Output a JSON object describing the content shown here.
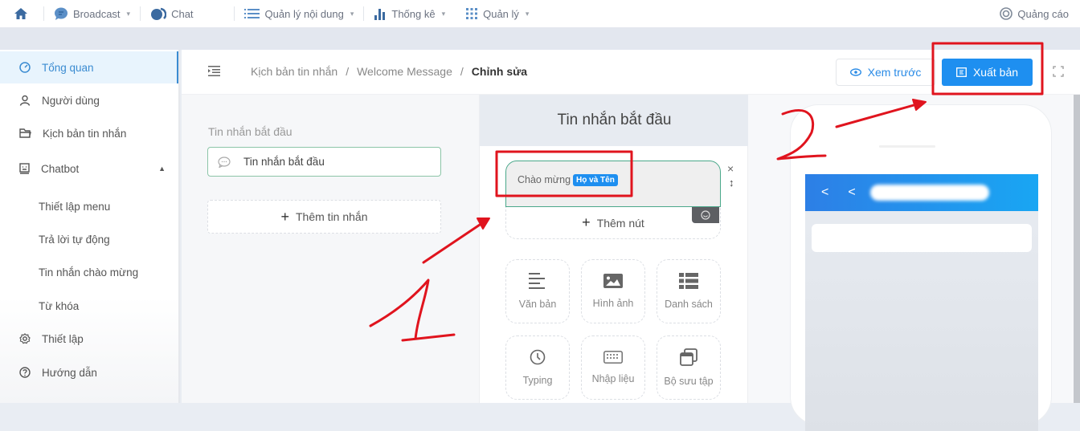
{
  "topnav": {
    "home_icon": "home-icon",
    "items": [
      {
        "label": "Broadcast",
        "icon": "chat-bubble-icon",
        "dropdown": true
      },
      {
        "label": "Chat",
        "icon": "chat-bubbles-icon",
        "dropdown": false
      },
      {
        "label": "Quản lý nội dung",
        "icon": "list-icon",
        "dropdown": true
      },
      {
        "label": "Thống kê",
        "icon": "bar-chart-icon",
        "dropdown": true
      },
      {
        "label": "Quản lý",
        "icon": "grid-icon",
        "dropdown": true
      }
    ],
    "caret": "▾",
    "ads": {
      "label": "Quảng cáo",
      "icon": "target-icon"
    }
  },
  "sidebar": {
    "items": [
      {
        "label": "Tổng quan",
        "icon": "dashboard-icon",
        "active": true
      },
      {
        "label": "Người dùng",
        "icon": "user-icon"
      },
      {
        "label": "Kịch bản tin nhắn",
        "icon": "folder-icon"
      },
      {
        "label": "Chatbot",
        "icon": "bot-icon",
        "expanded": true
      },
      {
        "label": "Thiết lập",
        "icon": "gear-icon"
      },
      {
        "label": "Hướng dẫn",
        "icon": "help-icon"
      }
    ],
    "chatbot_sub": [
      "Thiết lập menu",
      "Trả lời tự động",
      "Tin nhắn chào mừng",
      "Từ khóa"
    ],
    "collapse_glyph": "▲"
  },
  "header": {
    "breadcrumb": [
      "Kịch bản tin nhắn",
      "Welcome Message",
      "Chỉnh sửa"
    ],
    "separator": "/",
    "preview_label": "Xem trước",
    "publish_label": "Xuất bản"
  },
  "left_panel": {
    "section_label": "Tin nhắn bắt đầu",
    "message_item": "Tin nhắn bắt đầu",
    "add_message_label": "Thêm tin nhắn"
  },
  "editor": {
    "title": "Tin nhắn bắt đầu",
    "bubble_text": "Chào mừng",
    "bubble_tag": "Họ và Tên",
    "close_glyph": "×",
    "resize_glyph": "↕",
    "add_button_label": "Thêm nút",
    "plus": "+",
    "tiles": [
      {
        "label": "Văn bản",
        "icon": "text-align-icon"
      },
      {
        "label": "Hình ảnh",
        "icon": "image-icon"
      },
      {
        "label": "Danh sách",
        "icon": "list-table-icon"
      },
      {
        "label": "Typing",
        "icon": "clock-icon"
      },
      {
        "label": "Nhập liệu",
        "icon": "keyboard-icon"
      },
      {
        "label": "Bộ sưu tập",
        "icon": "gallery-icon"
      }
    ]
  },
  "preview": {
    "back_glyph": "<"
  },
  "annotations": {
    "color": "#e0141e",
    "labels": [
      "1",
      "2"
    ]
  },
  "colors": {
    "primary": "#1e8ff0",
    "active_text": "#3a8bd1",
    "active_bg": "#e8f4fd",
    "bubble_border": "#4aa88a"
  }
}
